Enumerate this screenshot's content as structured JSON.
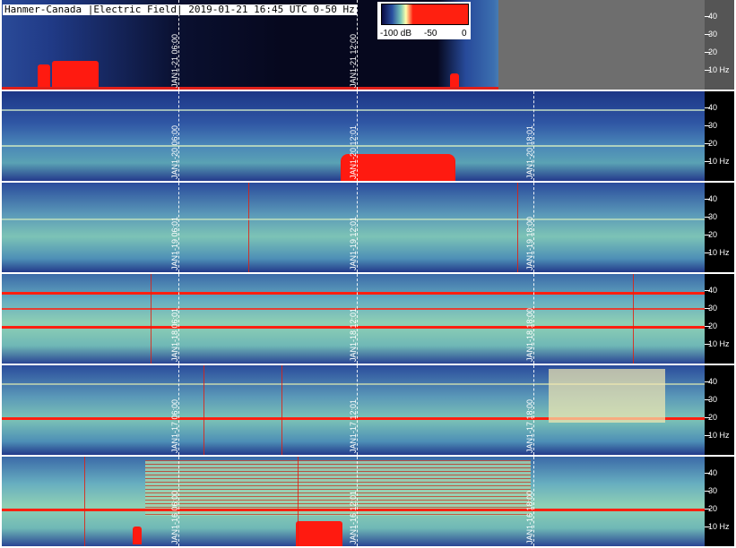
{
  "title": "Hanmer-Canada |Electric Field| 2019-01-21 16:45 UTC 0-50 Hz",
  "legend": {
    "min_label": "-100 dB",
    "mid_label": "-50",
    "max_label": "0"
  },
  "colors": {
    "background": "#000000",
    "low": "#1c3686",
    "mid": "#7cc3b6",
    "high": "#ff1a10",
    "time_marker": "#ffffff"
  },
  "chart_data": {
    "type": "heatmap",
    "title": "Hanmer-Canada |Electric Field| 2019-01-21 16:45 UTC 0-50 Hz",
    "ylabel": "Hz",
    "ylim": [
      0,
      50
    ],
    "y_ticks": [
      "40",
      "30",
      "20",
      "10 Hz"
    ],
    "colorbar": {
      "min": "-100 dB",
      "mid": "-50",
      "max": "0"
    },
    "rows": [
      {
        "day": "JAN1-21",
        "markers": [
          "JAN1-21 06:00",
          "JAN1-21 12:00"
        ]
      },
      {
        "day": "JAN1-20",
        "markers": [
          "JAN1-20 06:00",
          "JAN1-20 12:01",
          "JAN1-20 18:01"
        ]
      },
      {
        "day": "JAN1-19",
        "markers": [
          "JAN1-19 06:01",
          "JAN1-19 12:01",
          "JAN1-19 18:00"
        ]
      },
      {
        "day": "JAN1-18",
        "markers": [
          "JAN1-18 06:01",
          "JAN1-18 12:01",
          "JAN1-18 18:00"
        ]
      },
      {
        "day": "JAN1-17",
        "markers": [
          "JAN1-17 06:00",
          "JAN1-17 12:01",
          "JAN1-17 18:00"
        ]
      },
      {
        "day": "JAN1-16",
        "markers": [
          "JAN1-16 06:00",
          "JAN1-16 12:01",
          "JAN1-16 18:00"
        ]
      }
    ]
  }
}
